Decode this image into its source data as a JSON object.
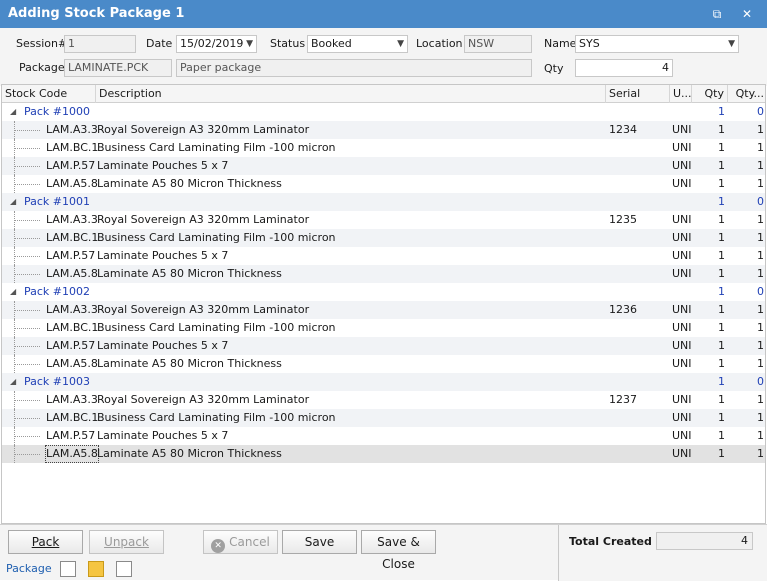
{
  "window": {
    "title": "Adding Stock Package 1"
  },
  "header": {
    "session_label": "Session#",
    "session_value": "1",
    "date_label": "Date",
    "date_value": "15/02/2019",
    "status_label": "Status",
    "status_value": "Booked",
    "location_label": "Location",
    "location_value": "NSW",
    "name_label": "Name",
    "name_value": "SYS",
    "package_label": "Package",
    "package_value": "LAMINATE.PCK",
    "package_desc": "Paper package",
    "qty_label": "Qty",
    "qty_value": "4"
  },
  "grid": {
    "columns": [
      "Stock Code",
      "Description",
      "Serial",
      "U...",
      "Qty",
      "Qty..."
    ],
    "rows": [
      {
        "type": "pack",
        "label": "Pack #1000",
        "qty": "1",
        "qty2": "0"
      },
      {
        "type": "item",
        "code": "LAM.A3.3",
        "desc": "Royal Sovereign A3 320mm Laminator",
        "serial": "1234",
        "unit": "UNI",
        "qty": "1",
        "qty2": "1"
      },
      {
        "type": "item",
        "code": "LAM.BC.1",
        "desc": "Business Card Laminating Film -100 micron",
        "serial": "",
        "unit": "UNI",
        "qty": "1",
        "qty2": "1"
      },
      {
        "type": "item",
        "code": "LAM.P.57",
        "desc": "Laminate Pouches 5 x 7",
        "serial": "",
        "unit": "UNI",
        "qty": "1",
        "qty2": "1"
      },
      {
        "type": "item",
        "code": "LAM.A5.8",
        "desc": "Laminate A5 80 Micron Thickness",
        "serial": "",
        "unit": "UNI",
        "qty": "1",
        "qty2": "1"
      },
      {
        "type": "pack",
        "label": "Pack #1001",
        "qty": "1",
        "qty2": "0"
      },
      {
        "type": "item",
        "code": "LAM.A3.3",
        "desc": "Royal Sovereign A3 320mm Laminator",
        "serial": "1235",
        "unit": "UNI",
        "qty": "1",
        "qty2": "1"
      },
      {
        "type": "item",
        "code": "LAM.BC.1",
        "desc": "Business Card Laminating Film -100 micron",
        "serial": "",
        "unit": "UNI",
        "qty": "1",
        "qty2": "1"
      },
      {
        "type": "item",
        "code": "LAM.P.57",
        "desc": "Laminate Pouches 5 x 7",
        "serial": "",
        "unit": "UNI",
        "qty": "1",
        "qty2": "1"
      },
      {
        "type": "item",
        "code": "LAM.A5.8",
        "desc": "Laminate A5 80 Micron Thickness",
        "serial": "",
        "unit": "UNI",
        "qty": "1",
        "qty2": "1"
      },
      {
        "type": "pack",
        "label": "Pack #1002",
        "qty": "1",
        "qty2": "0"
      },
      {
        "type": "item",
        "code": "LAM.A3.3",
        "desc": "Royal Sovereign A3 320mm Laminator",
        "serial": "1236",
        "unit": "UNI",
        "qty": "1",
        "qty2": "1"
      },
      {
        "type": "item",
        "code": "LAM.BC.1",
        "desc": "Business Card Laminating Film -100 micron",
        "serial": "",
        "unit": "UNI",
        "qty": "1",
        "qty2": "1"
      },
      {
        "type": "item",
        "code": "LAM.P.57",
        "desc": "Laminate Pouches 5 x 7",
        "serial": "",
        "unit": "UNI",
        "qty": "1",
        "qty2": "1"
      },
      {
        "type": "item",
        "code": "LAM.A5.8",
        "desc": "Laminate A5 80 Micron Thickness",
        "serial": "",
        "unit": "UNI",
        "qty": "1",
        "qty2": "1"
      },
      {
        "type": "pack",
        "label": "Pack #1003",
        "qty": "1",
        "qty2": "0"
      },
      {
        "type": "item",
        "code": "LAM.A3.3",
        "desc": "Royal Sovereign A3 320mm Laminator",
        "serial": "1237",
        "unit": "UNI",
        "qty": "1",
        "qty2": "1"
      },
      {
        "type": "item",
        "code": "LAM.BC.1",
        "desc": "Business Card Laminating Film -100 micron",
        "serial": "",
        "unit": "UNI",
        "qty": "1",
        "qty2": "1"
      },
      {
        "type": "item",
        "code": "LAM.P.57",
        "desc": "Laminate Pouches 5 x 7",
        "serial": "",
        "unit": "UNI",
        "qty": "1",
        "qty2": "1"
      },
      {
        "type": "item",
        "code": "LAM.A5.8",
        "desc": "Laminate A5 80 Micron Thickness",
        "serial": "",
        "unit": "UNI",
        "qty": "1",
        "qty2": "1",
        "selected": true
      }
    ]
  },
  "footer": {
    "pack_label": "Pack",
    "unpack_label": "Unpack",
    "cancel_label": "Cancel",
    "save_label": "Save",
    "save_close_label": "Save & Close",
    "total_label": "Total Created",
    "total_value": "4",
    "tab_package": "Package"
  },
  "colors": {
    "titlebar": "#4a8ac9",
    "pack_text": "#1f3fb5"
  }
}
